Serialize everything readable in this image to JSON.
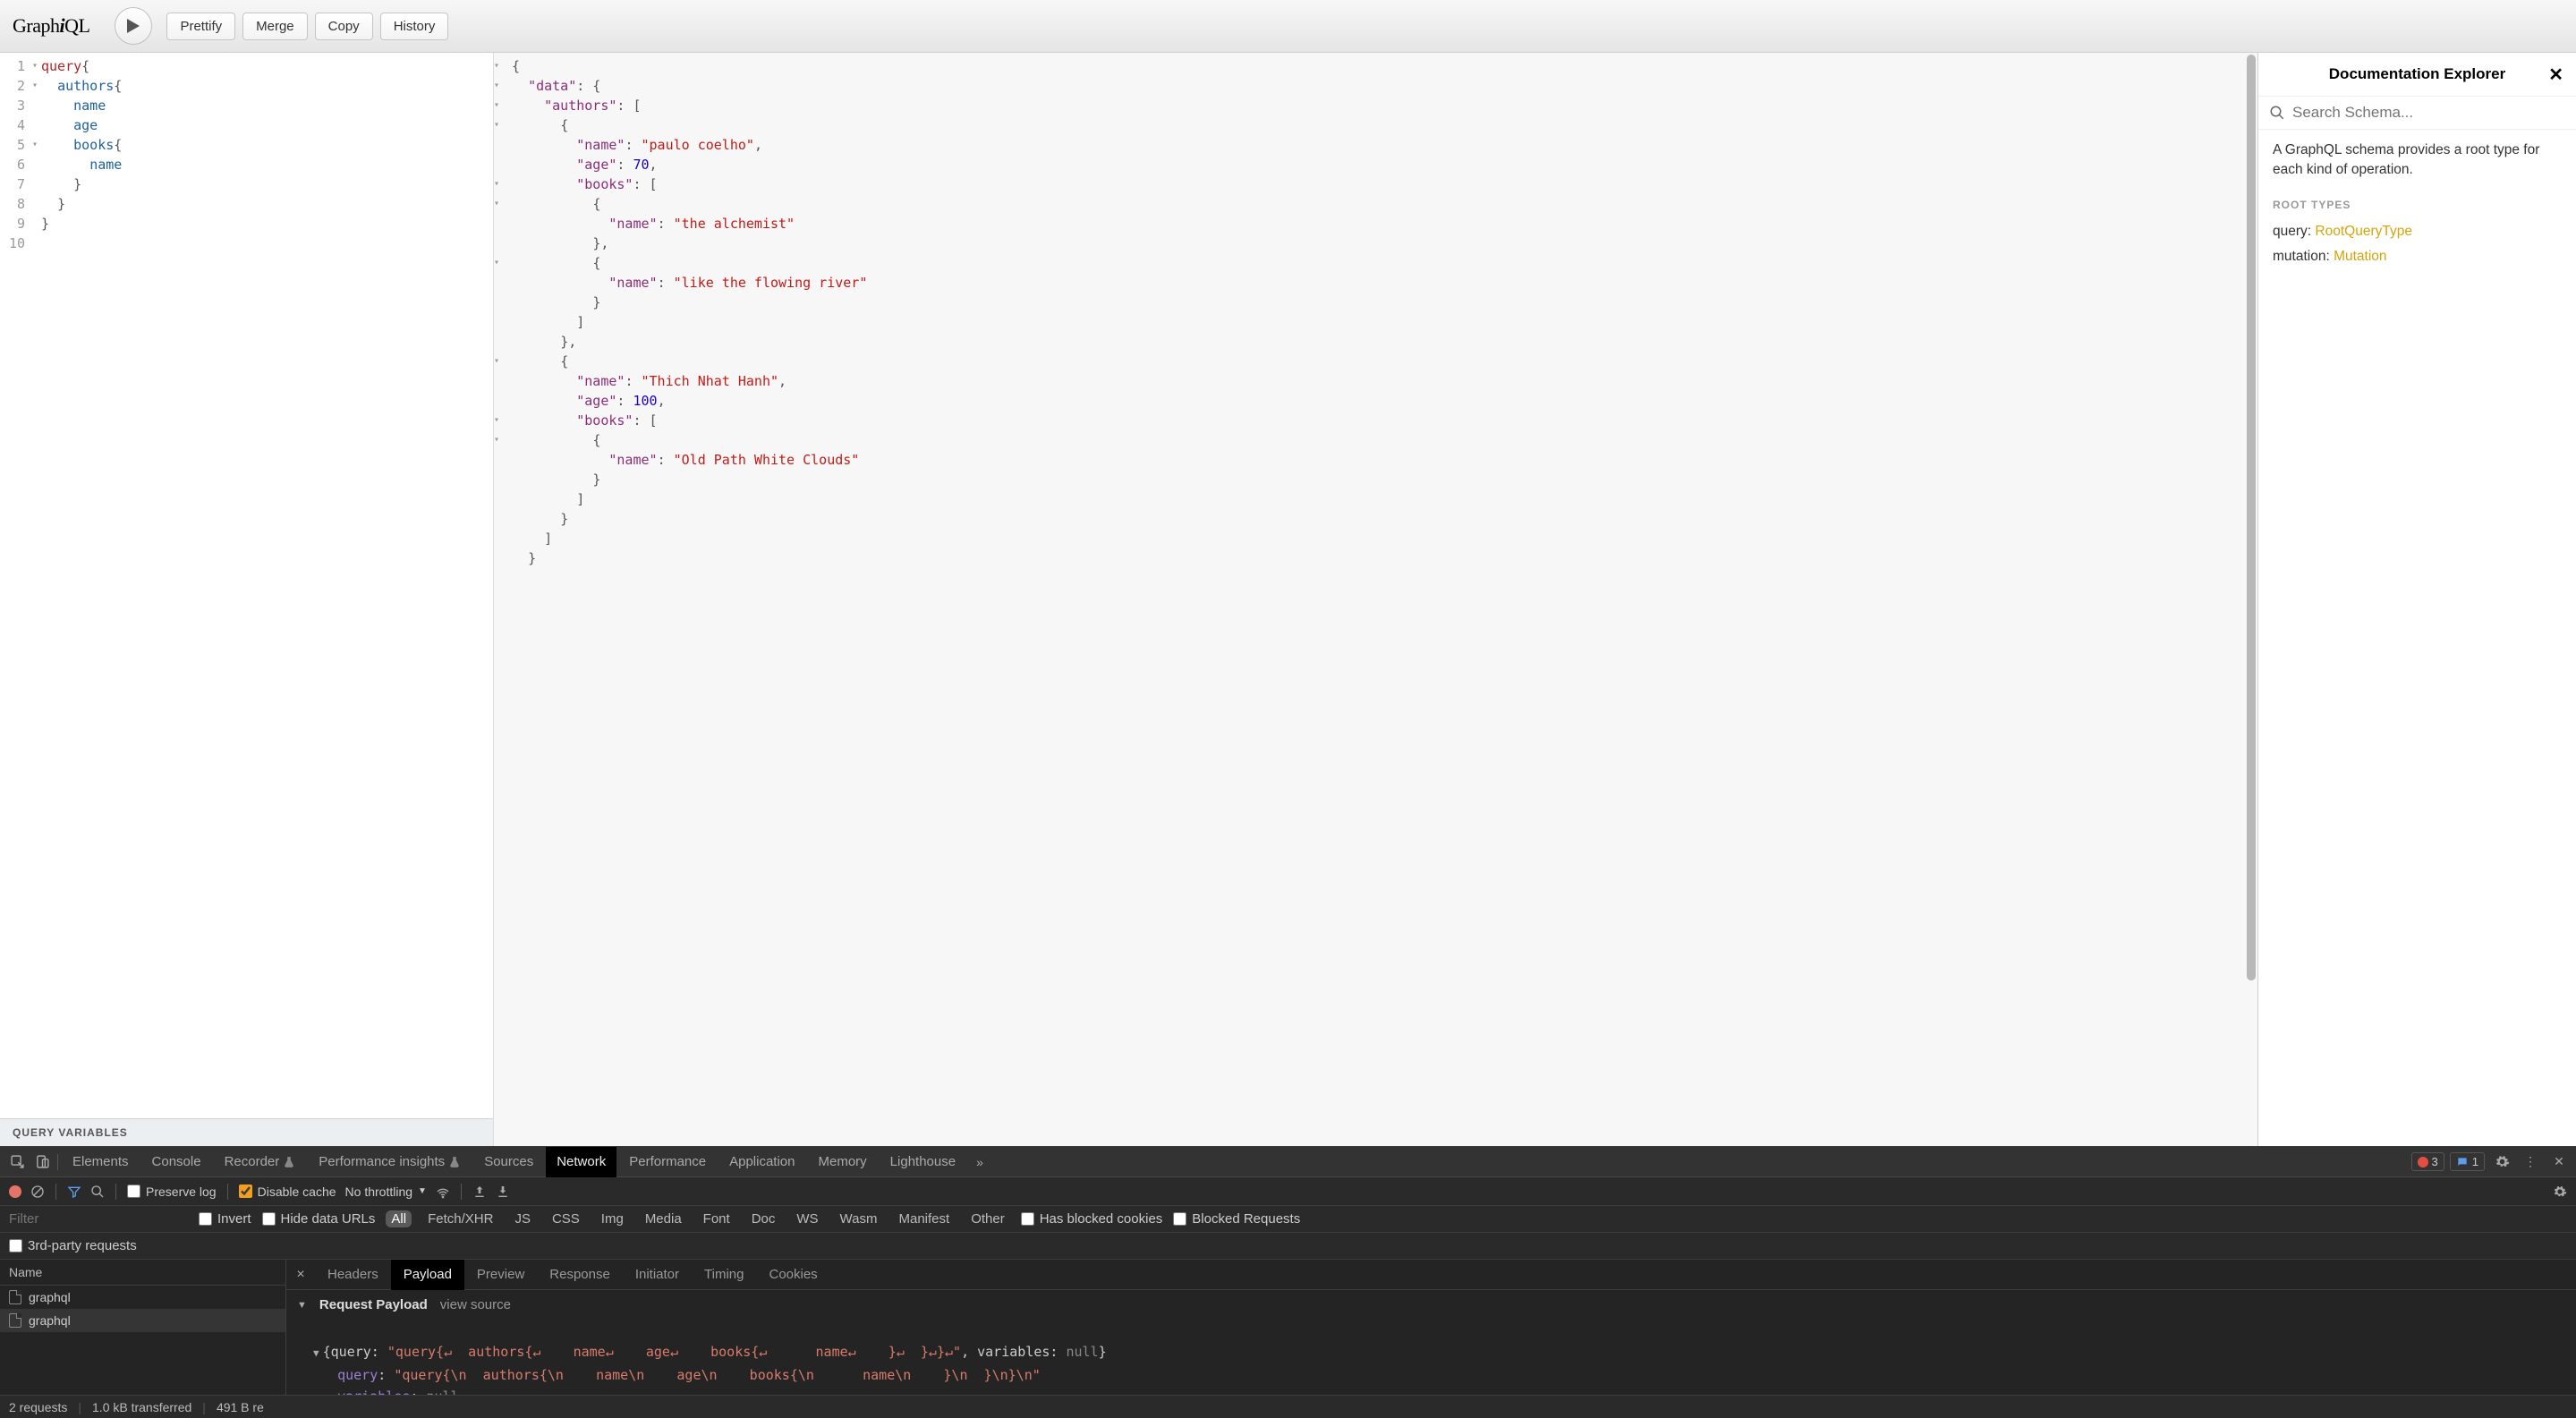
{
  "toolbar": {
    "logo_a": "Graph",
    "logo_b": "i",
    "logo_c": "QL",
    "prettify": "Prettify",
    "merge": "Merge",
    "copy": "Copy",
    "history": "History"
  },
  "editor": {
    "lines": [
      "1",
      "2",
      "3",
      "4",
      "5",
      "6",
      "7",
      "8",
      "9",
      "10"
    ],
    "variables_label": "QUERY VARIABLES"
  },
  "query_tokens": {
    "query": "query",
    "ob": "{",
    "authors": "authors",
    "name": "name",
    "age": "age",
    "books": "books",
    "cb": "}"
  },
  "response": {
    "data_key": "\"data\"",
    "authors_key": "\"authors\"",
    "name_key": "\"name\"",
    "age_key": "\"age\"",
    "books_key": "\"books\"",
    "a1_name": "\"paulo coelho\"",
    "a1_age": "70",
    "b1": "\"the alchemist\"",
    "b2": "\"like the flowing river\"",
    "a2_name": "\"Thich Nhat Hanh\"",
    "a2_age": "100",
    "b3": "\"Old Path White Clouds\""
  },
  "docs": {
    "title": "Documentation Explorer",
    "search_placeholder": "Search Schema...",
    "description": "A GraphQL schema provides a root type for each kind of operation.",
    "section": "ROOT TYPES",
    "query_label": "query",
    "query_type": "RootQueryType",
    "mutation_label": "mutation",
    "mutation_type": "Mutation"
  },
  "devtools": {
    "tabs": {
      "elements": "Elements",
      "console": "Console",
      "recorder": "Recorder",
      "perf_insights": "Performance insights",
      "sources": "Sources",
      "network": "Network",
      "performance": "Performance",
      "application": "Application",
      "memory": "Memory",
      "lighthouse": "Lighthouse"
    },
    "err_count": "3",
    "msg_count": "1",
    "tb": {
      "preserve": "Preserve log",
      "disable_cache": "Disable cache",
      "throttling": "No throttling"
    },
    "filter": {
      "placeholder": "Filter",
      "invert": "Invert",
      "hide": "Hide data URLs",
      "all": "All",
      "xhr": "Fetch/XHR",
      "js": "JS",
      "css": "CSS",
      "img": "Img",
      "media": "Media",
      "font": "Font",
      "doc": "Doc",
      "ws": "WS",
      "wasm": "Wasm",
      "manifest": "Manifest",
      "other": "Other",
      "blocked_cookies": "Has blocked cookies",
      "blocked_req": "Blocked Requests",
      "third_party": "3rd-party requests"
    },
    "list": {
      "name_col": "Name",
      "r1": "graphql",
      "r2": "graphql"
    },
    "detail": {
      "headers": "Headers",
      "payload": "Payload",
      "preview": "Preview",
      "response": "Response",
      "initiator": "Initiator",
      "timing": "Timing",
      "cookies": "Cookies",
      "section": "Request Payload",
      "view_source": "view source",
      "line1_a": "{query: ",
      "line1_b": "\"query{↵  authors{↵    name↵    age↵    books{↵      name↵    }↵  }↵}↵\"",
      "line1_c": ", variables: ",
      "line1_d": "null",
      "line1_e": "}",
      "qk": "query",
      "qv": "\"query{\\n  authors{\\n    name\\n    age\\n    books{\\n      name\\n    }\\n  }\\n}\\n\"",
      "vk": "variables",
      "vv": "null"
    },
    "status": {
      "reqs": "2 requests",
      "xfer": "1.0 kB transferred",
      "res": "491 B re"
    }
  }
}
